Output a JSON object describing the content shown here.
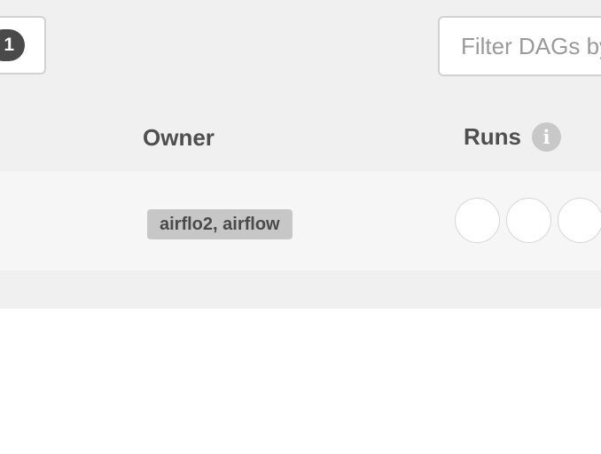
{
  "toolbar": {
    "status_count": "1",
    "filter_placeholder": "Filter DAGs by tag"
  },
  "table": {
    "columns": {
      "owner": "Owner",
      "runs": "Runs",
      "runs_info_icon": "info-icon"
    },
    "rows": [
      {
        "owner": "airflo2, airflow",
        "runs": [
          {
            "status": "empty"
          },
          {
            "status": "empty"
          },
          {
            "status": "empty"
          }
        ]
      }
    ]
  },
  "colors": {
    "header_bg": "#f0f0f0",
    "row_bg": "#f6f6f6",
    "badge_bg": "#c7c7c7",
    "count_badge_bg": "#4a4a4a"
  }
}
